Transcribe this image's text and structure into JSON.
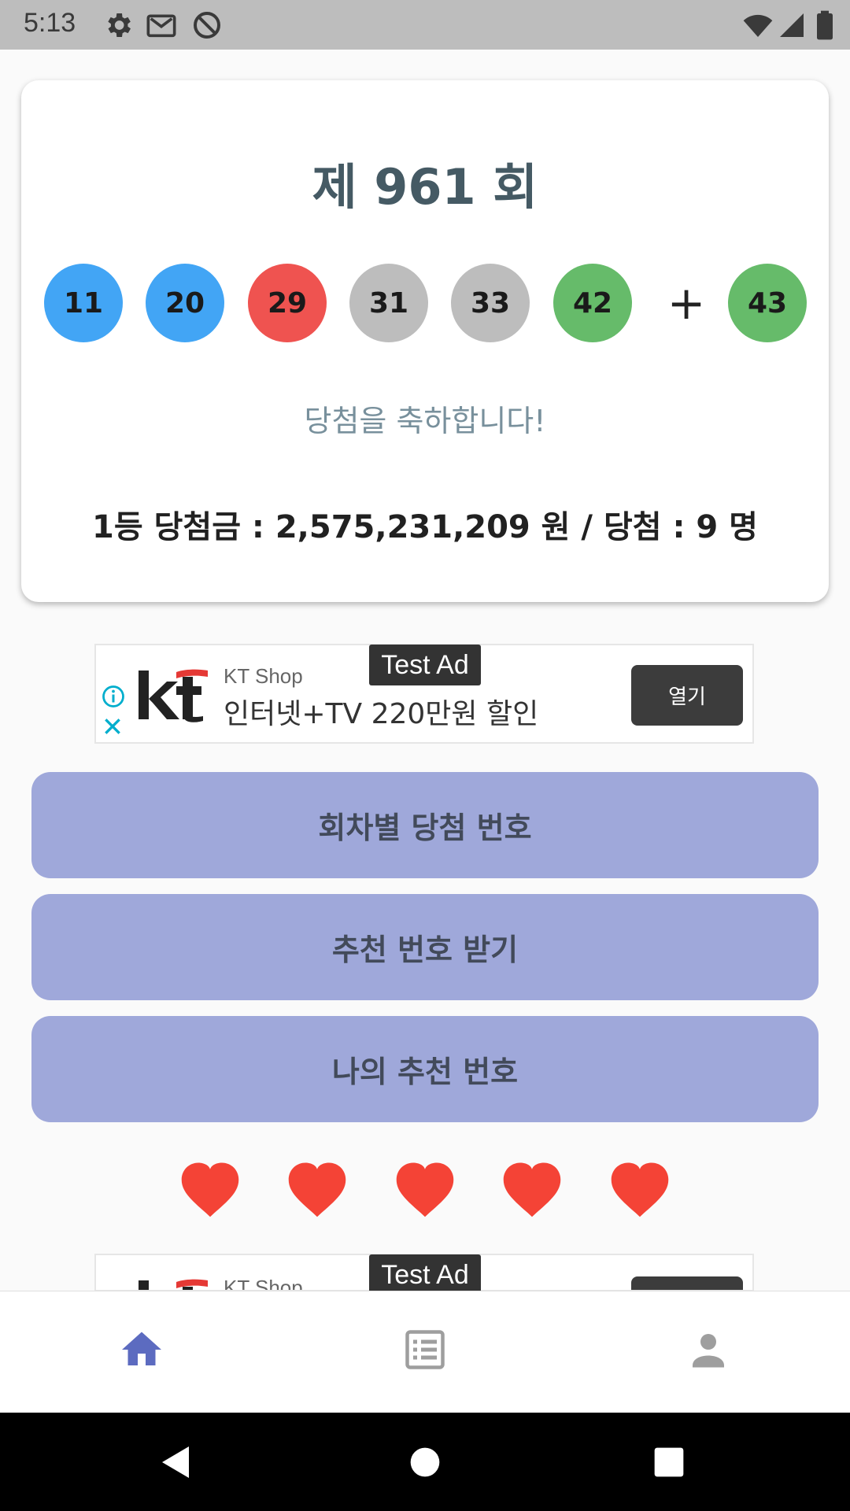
{
  "status_bar": {
    "time": "5:13",
    "left_icons": [
      "settings-icon",
      "gmail-icon",
      "no-disturb-icon"
    ],
    "right_icons": [
      "wifi-icon",
      "signal-icon",
      "battery-icon"
    ]
  },
  "draw": {
    "title": "제 961 회",
    "numbers": [
      {
        "value": "11",
        "color": "#42a5f5"
      },
      {
        "value": "20",
        "color": "#42a5f5"
      },
      {
        "value": "29",
        "color": "#ef5350"
      },
      {
        "value": "31",
        "color": "#bdbdbd"
      },
      {
        "value": "33",
        "color": "#bdbdbd"
      },
      {
        "value": "42",
        "color": "#66bb6a"
      }
    ],
    "plus": "+",
    "bonus": {
      "value": "43",
      "color": "#66bb6a"
    },
    "congrats": "당첨을 축하합니다!",
    "prize": "1등 당첨금 : 2,575,231,209 원 / 당첨 : 9 명"
  },
  "ads": [
    {
      "badge": "Test Ad",
      "brand": "KT Shop",
      "headline": "인터넷+TV 220만원 할인",
      "button": "열기"
    },
    {
      "badge": "Test Ad",
      "brand": "KT Shop"
    }
  ],
  "buttons": {
    "history": "회차별 당첨 번호",
    "recommend": "추천 번호 받기",
    "my_numbers": "나의 추천 번호"
  },
  "hearts": {
    "filled": 5,
    "total": 5,
    "color": "#f44336"
  },
  "bottom_nav": {
    "items": [
      {
        "icon": "home-icon",
        "active": true
      },
      {
        "icon": "list-icon",
        "active": false
      },
      {
        "icon": "person-icon",
        "active": false
      }
    ],
    "active_color": "#5c6bc0",
    "inactive_color": "#9e9e9e"
  },
  "system_nav": [
    "back-icon",
    "home-circle-icon",
    "recents-icon"
  ]
}
